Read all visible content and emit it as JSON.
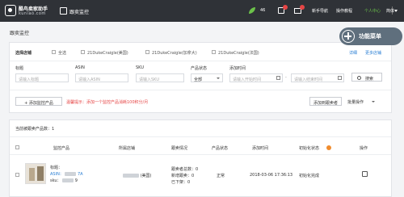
{
  "topbar": {
    "logo_name": "酷鸟卖家助手",
    "logo_domain": "kuniao.com",
    "module_title": "跟卖监控",
    "leaf_count": "46",
    "calendar_badge": "",
    "mail_badge": "",
    "help_label": "新手导航",
    "tutorial_label": "操作教程",
    "user_label": "个人中心",
    "lang_label": "简体"
  },
  "page": {
    "title": "跟卖监控"
  },
  "float_menu": {
    "label": "功能菜单"
  },
  "filters": {
    "store_label": "选择店铺",
    "store_all": "全选",
    "stores": [
      "21DukeCraigle(美国)",
      "21DukeCraigle(加拿大)",
      "21DukeCraigle(法国)"
    ],
    "expand_label": "详细",
    "more_stores_label": "更多店铺",
    "title_label": "标题",
    "title_placeholder": "请输入标题",
    "asin_label": "ASIN",
    "asin_placeholder": "请输入ASIN",
    "sku_label": "SKU",
    "sku_placeholder": "请输入SKU",
    "status_label": "产品状态",
    "status_value": "全部",
    "time_label": "添加时间",
    "start_placeholder": "请输入开始时间",
    "end_placeholder": "请输入结束时间",
    "search_label": "搜索",
    "add_button": "添加监控产品",
    "warning": "温馨提示：添加一个监控产品消耗100积分/月",
    "owner_button": "添加到跟卖者",
    "batch_button": "批量操作"
  },
  "table": {
    "count_label": "当前被跟卖产品数：1",
    "headers": [
      "监控产品",
      "所属店铺",
      "跟卖情况",
      "产品状态",
      "添加时间",
      "初始化状态",
      "操作"
    ],
    "rows": [
      {
        "title": "标题：",
        "asin": "ASIN：",
        "asin_value": "7A",
        "sku": "sku：",
        "sku_value": "9",
        "store": "(美国)",
        "follow_total": "跟卖者总数：0",
        "follow_new": "新增跟卖：0",
        "follow_left": "已下架：0",
        "status": "正常",
        "added": "2018-03-06 17:36:13",
        "init_status": "初始化完成"
      }
    ]
  },
  "colors": {
    "topbar": "#2f3237",
    "link": "#2a7fd4",
    "warning": "#e64545",
    "accent": "#f08c2e"
  }
}
